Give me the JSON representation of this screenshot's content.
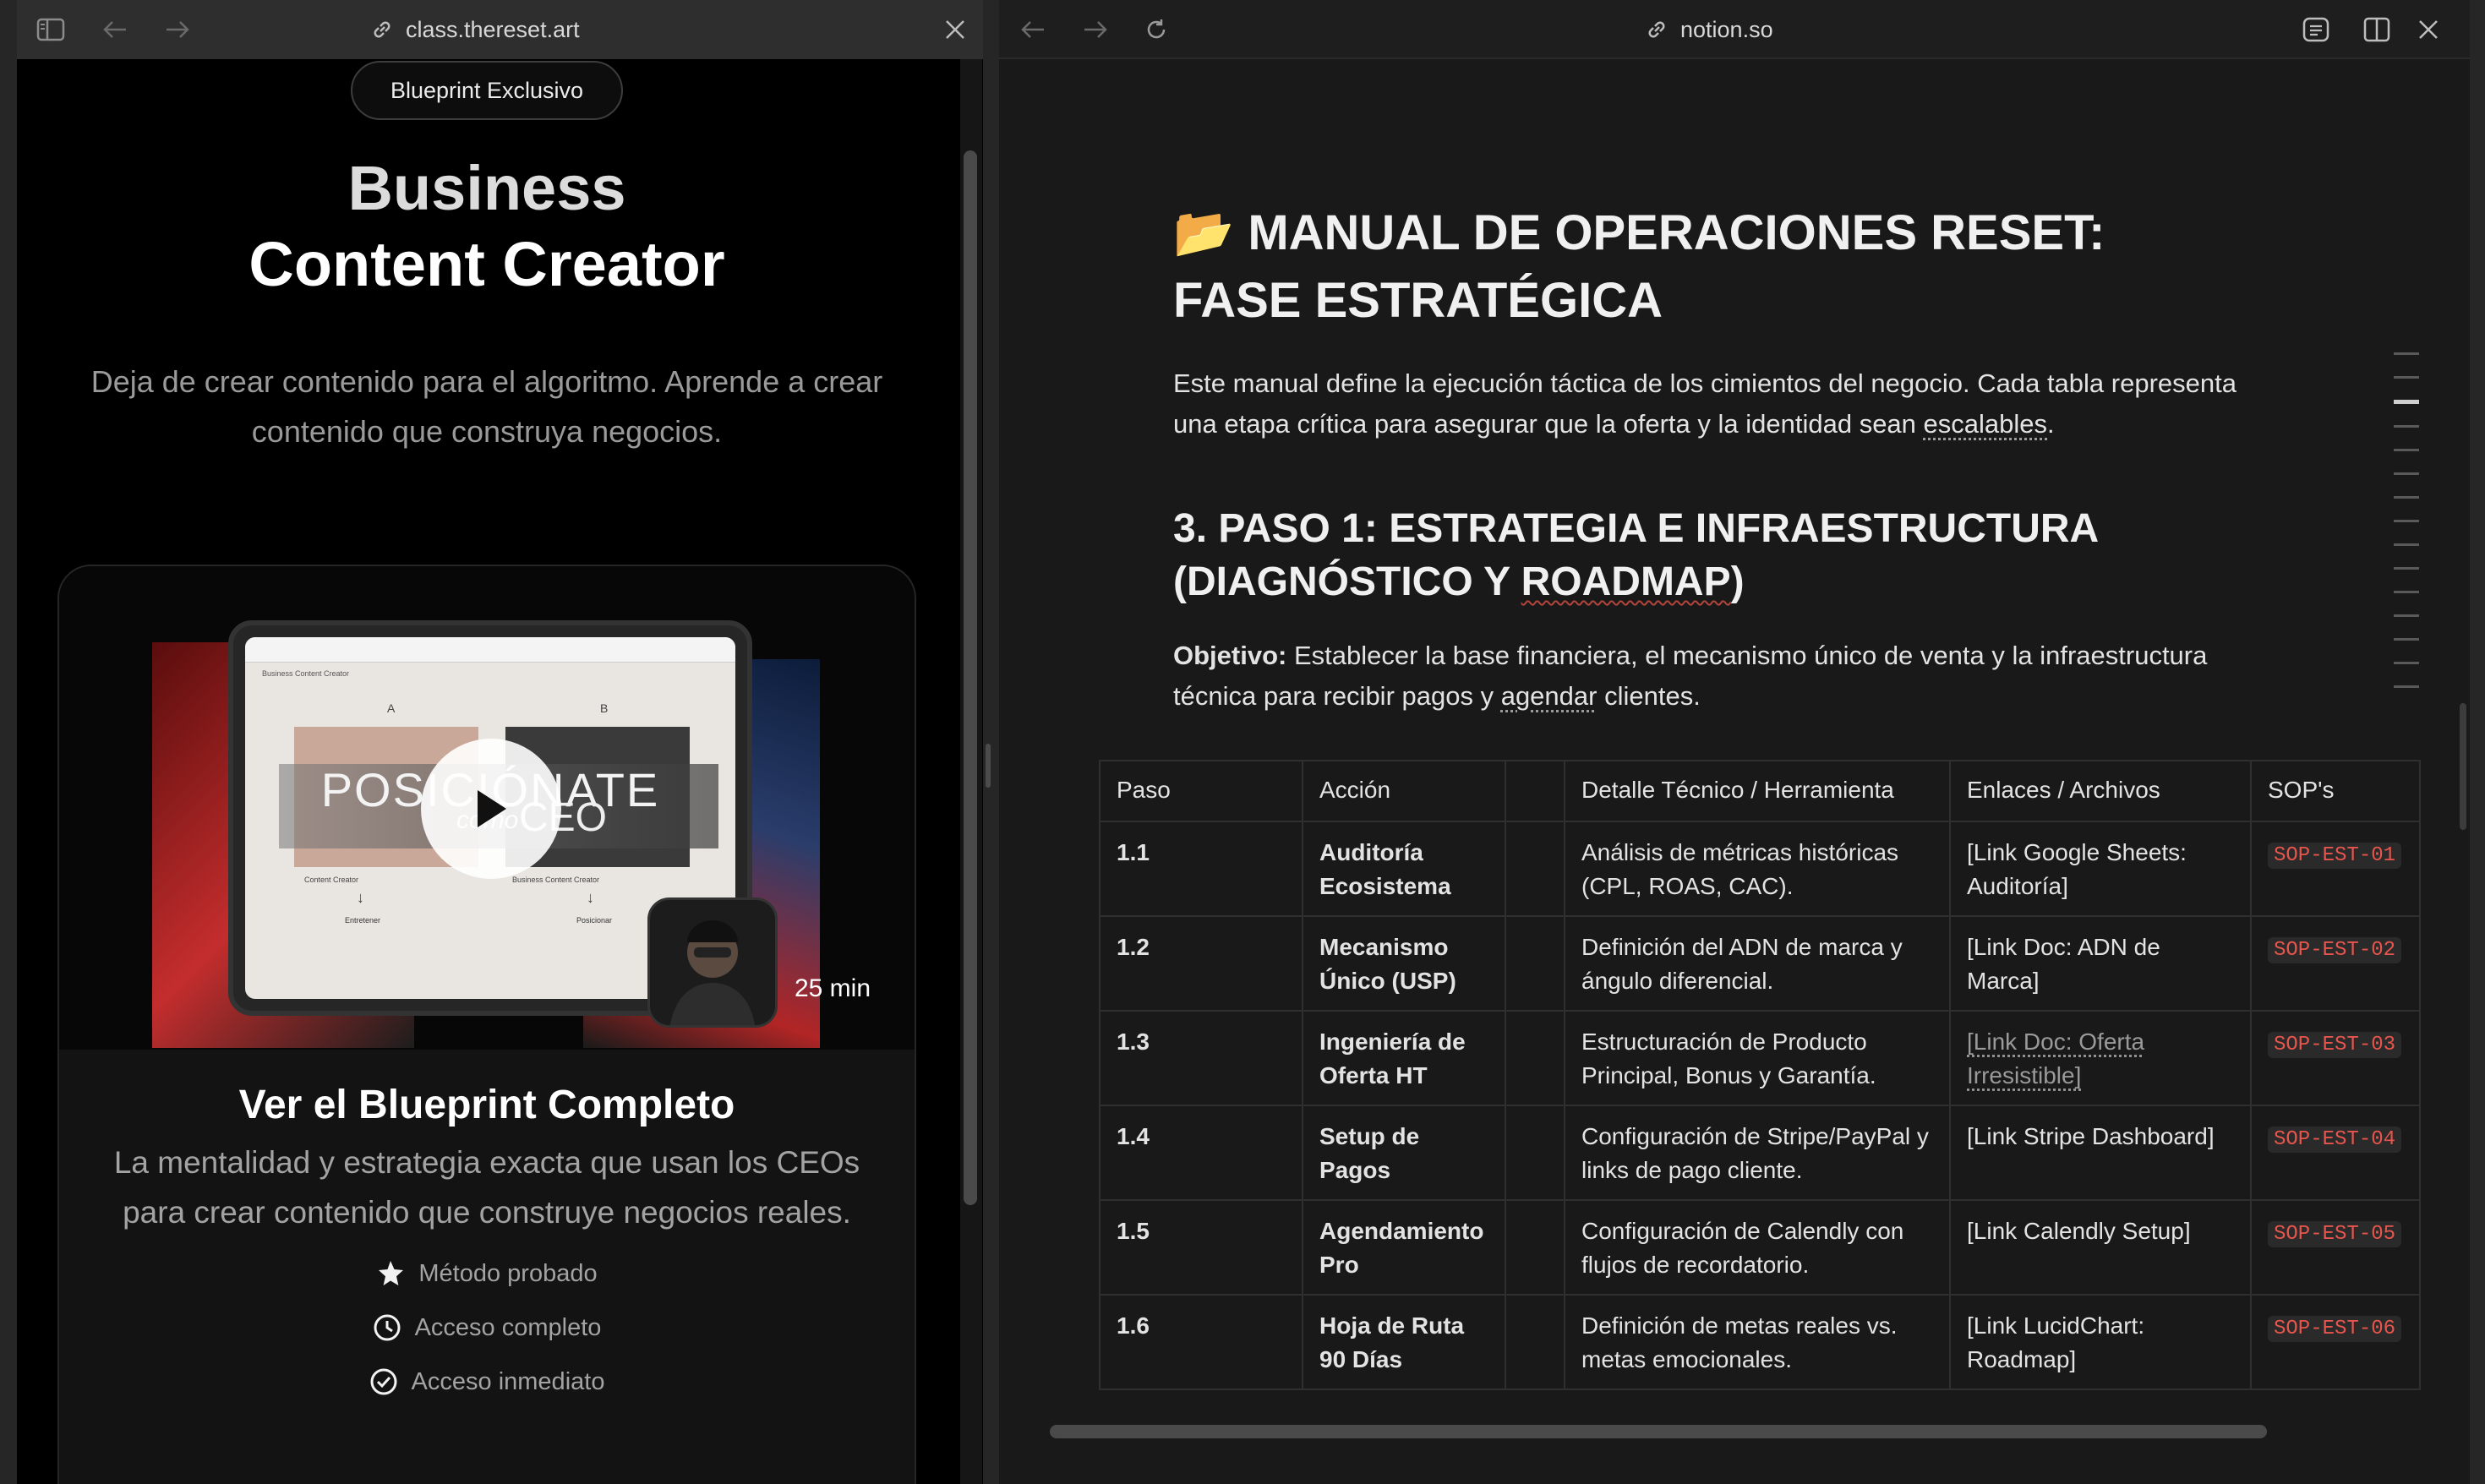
{
  "left_window": {
    "url": "class.thereset.art",
    "badge": "Blueprint Exclusivo",
    "title_line1": "Business",
    "title_line2": "Content Creator",
    "subtitle": "Deja de crear contenido para el algoritmo. Aprende a crear contenido que construya negocios.",
    "video": {
      "overlay_text": "POSICIÓNATE",
      "overlay_small": "como",
      "overlay_end": "CEO",
      "duration": "25 min",
      "slide_header": "Business Content Creator",
      "col_a": "A",
      "col_b": "B",
      "label_a": "Content Creator",
      "label_b": "Business Content Creator",
      "bottom_a": "Entretener",
      "bottom_b": "Posicionar"
    },
    "card_title": "Ver el Blueprint Completo",
    "card_desc": "La mentalidad y estrategia exacta que usan los CEOs para crear contenido que construye negocios reales.",
    "features": [
      {
        "icon": "star-icon",
        "label": "Método probado"
      },
      {
        "icon": "clock-icon",
        "label": "Acceso completo"
      },
      {
        "icon": "check-circle-icon",
        "label": "Acceso inmediato"
      }
    ]
  },
  "right_window": {
    "url": "notion.so",
    "doc_icon": "📂",
    "doc_title": "MANUAL DE OPERACIONES RESET: FASE ESTRATÉGICA",
    "intro_a": "Este manual define la ejecución táctica de los cimientos del negocio. Cada tabla representa una etapa crítica para asegurar que la oferta y la identidad sean ",
    "intro_b": "escalables",
    "intro_c": ".",
    "section_a": "3. PASO 1: ESTRATEGIA E INFRAESTRUCTURA (DIAGNÓSTICO Y ",
    "section_b": "ROADMAP",
    "section_c": ")",
    "objective_label": "Objetivo:",
    "objective_a": " Establecer la base financiera, el mecanismo único de venta y la infraestructura técnica para recibir pagos y ",
    "objective_b": "agendar",
    "objective_c": " clientes.",
    "table": {
      "headers": [
        "Paso",
        "Acción",
        "",
        "Detalle Técnico / Herramienta",
        "Enlaces / Archivos",
        "SOP's"
      ],
      "rows": [
        {
          "paso": "1.1",
          "accion": "Auditoría Ecosistema",
          "detalle": "Análisis de métricas históricas (CPL, ROAS, CAC).",
          "enlace": "[Link Google Sheets: Auditoría]",
          "sop": "SOP-EST-01"
        },
        {
          "paso": "1.2",
          "accion": "Mecanismo Único (USP)",
          "detalle": "Definición del ADN de marca y ángulo diferencial.",
          "enlace": "[Link Doc: ADN de Marca]",
          "sop": "SOP-EST-02"
        },
        {
          "paso": "1.3",
          "accion": "Ingeniería de Oferta HT",
          "detalle": "Estructuración de Producto Principal, Bonus y Garantía.",
          "enlace": "[Link Doc: Oferta Irresistible]",
          "sop": "SOP-EST-03"
        },
        {
          "paso": "1.4",
          "accion": "Setup de Pagos",
          "detalle": "Configuración de Stripe/PayPal y links de pago cliente.",
          "enlace": "[Link Stripe Dashboard]",
          "sop": "SOP-EST-04"
        },
        {
          "paso": "1.5",
          "accion": "Agendamiento Pro",
          "detalle": "Configuración de Calendly con flujos de recordatorio.",
          "enlace": "[Link Calendly Setup]",
          "sop": "SOP-EST-05"
        },
        {
          "paso": "1.6",
          "accion": "Hoja de Ruta 90 Días",
          "detalle": "Definición de metas reales vs. metas emocionales.",
          "enlace": "[Link LucidChart: Roadmap]",
          "sop": "SOP-EST-06"
        }
      ]
    }
  }
}
